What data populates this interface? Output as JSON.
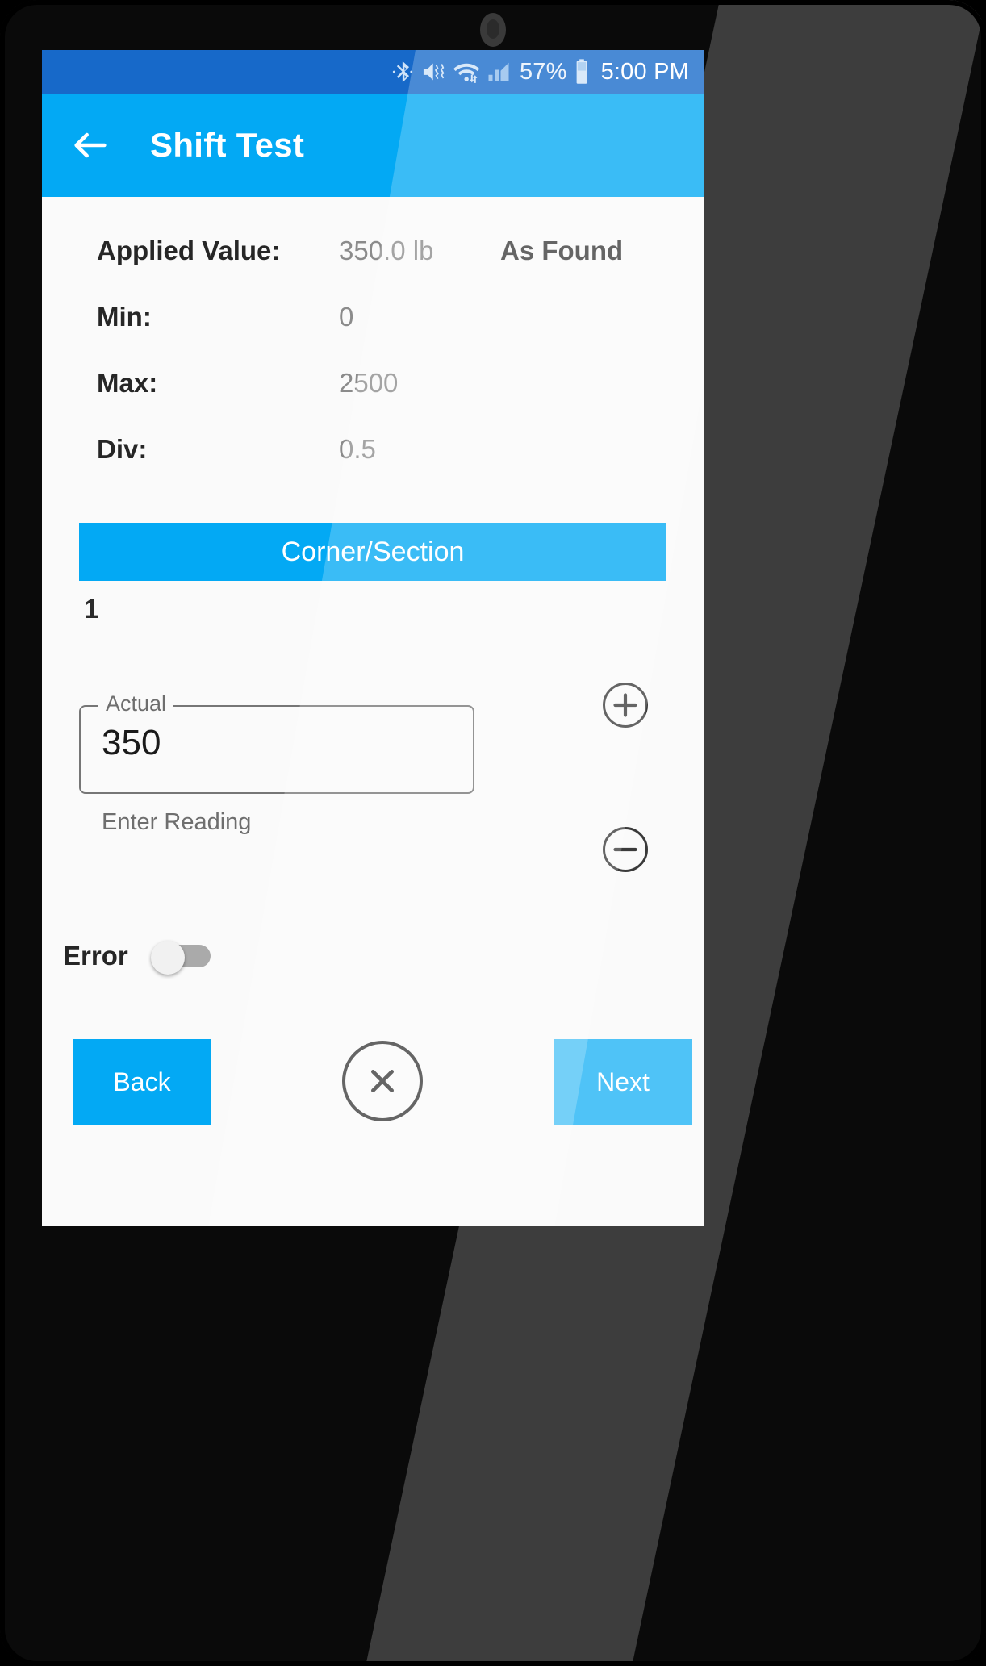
{
  "status_bar": {
    "icons": [
      "bluetooth-icon",
      "mute-vibrate-icon",
      "wifi-icon",
      "cell-signal-icon",
      "battery-icon"
    ],
    "battery_percent": "57%",
    "time": "5:00 PM",
    "background_color": "#1769c9"
  },
  "app_bar": {
    "back_icon": "back-arrow-icon",
    "title": "Shift Test",
    "background_color": "#03a9f4"
  },
  "info_rows": [
    {
      "label": "Applied Value:",
      "value": "350.0 lb",
      "extra": "As Found"
    },
    {
      "label": "Min:",
      "value": "0",
      "extra": ""
    },
    {
      "label": "Max:",
      "value": "2500",
      "extra": ""
    },
    {
      "label": "Div:",
      "value": "0.5",
      "extra": ""
    }
  ],
  "corner_section": {
    "header": "Corner/Section",
    "value": "1",
    "header_color": "#03a9f4"
  },
  "actual_input": {
    "legend": "Actual",
    "value": "350",
    "helper": "Enter Reading",
    "plus_icon": "plus-circle-icon",
    "minus_icon": "minus-circle-icon"
  },
  "error_toggle": {
    "label": "Error",
    "state": "off"
  },
  "bottom_buttons": {
    "back": "Back",
    "next": "Next",
    "cancel_icon": "close-circle-icon"
  }
}
